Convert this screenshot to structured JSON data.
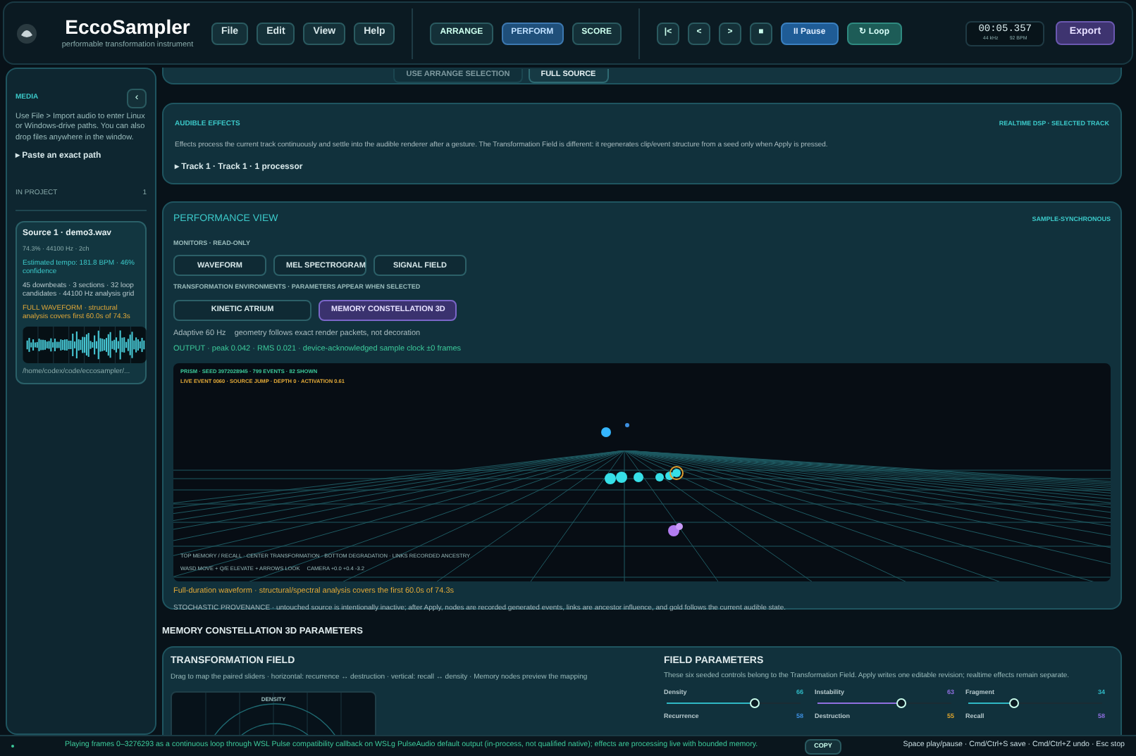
{
  "app": {
    "title": "EccoSampler",
    "subtitle": "performable transformation instrument"
  },
  "menu": [
    {
      "label": "File"
    },
    {
      "label": "Edit"
    },
    {
      "label": "View"
    },
    {
      "label": "Help"
    }
  ],
  "modes": [
    {
      "label": "ARRANGE",
      "selected": false
    },
    {
      "label": "PERFORM",
      "selected": true
    },
    {
      "label": "SCORE",
      "selected": false
    }
  ],
  "transport": [
    {
      "label": "|<",
      "kind": "step"
    },
    {
      "label": "<",
      "kind": "step"
    },
    {
      "label": ">",
      "kind": "step"
    },
    {
      "label": "■",
      "kind": "step"
    },
    {
      "label": "II Pause",
      "kind": "play"
    },
    {
      "label": "↻ Loop",
      "kind": "loop"
    }
  ],
  "clock": {
    "time": "00:05.357",
    "rate": "44 kHz",
    "tempo": "92 BPM"
  },
  "export": "Export",
  "sidebar": {
    "title": "MEDIA",
    "collapse": "‹",
    "help": "Use File > Import audio to enter Linux or Windows-drive paths. You can also drop files anywhere in the window.",
    "paste": "▸ Paste an exact path",
    "project_label": "IN PROJECT",
    "project_count": "1",
    "source": {
      "name": "Source 1 · demo3.wav",
      "meta": "74.3% · 44100 Hz · 2ch",
      "tempo": "Estimated tempo: 181.8 BPM · 46% confidence",
      "analysis": "45 downbeats · 3 sections · 32 loop candidates · 44100 Hz analysis grid",
      "warning": "FULL WAVEFORM · structural analysis covers first 60.0s of 74.3s",
      "path": "/home/codex/code/eccosampler/..."
    }
  },
  "scope": [
    {
      "label": "USE ARRANGE SELECTION",
      "selected": false
    },
    {
      "label": "FULL SOURCE",
      "selected": true
    }
  ],
  "effects": {
    "title": "AUDIBLE EFFECTS",
    "tag": "REALTIME DSP · SELECTED TRACK",
    "text": "Effects process the current track continuously and settle into the audible renderer after a gesture. The Transformation Field is different: it regenerates clip/event structure from a seed only when Apply is pressed.",
    "track": "▸ Track 1 · Track 1 · 1 processor"
  },
  "performance": {
    "title": "PERFORMANCE VIEW",
    "tag": "SAMPLE-SYNCHRONOUS",
    "monitors_label": "MONITORS · READ-ONLY",
    "monitors": [
      {
        "label": "WAVEFORM",
        "selected": false
      },
      {
        "label": "MEL SPECTROGRAM",
        "selected": false
      },
      {
        "label": "SIGNAL FIELD",
        "selected": false
      }
    ],
    "environments_label": "TRANSFORMATION ENVIRONMENTS · PARAMETERS APPEAR WHEN SELECTED",
    "environments": [
      {
        "label": "KINETIC ATRIUM",
        "selected": false
      },
      {
        "label": "MEMORY CONSTELLATION 3D",
        "selected": true
      }
    ],
    "rate": "Adaptive 60 Hz",
    "rate_note": "geometry follows exact render packets, not decoration",
    "output": "OUTPUT · peak 0.042 · RMS 0.021 · device-acknowledged sample clock ±0 frames",
    "canvas": {
      "prism": "PRISM · SEED 3972028945 · 799 EVENTS · 82 SHOWN",
      "live": "LIVE EVENT 0060 · SOURCE JUMP · DEPTH 0 · ACTIVATION 0.61",
      "legend": "TOP MEMORY / RECALL · CENTER TRANSFORMATION · BOTTOM DEGRADATION · LINKS RECORDED ANCESTRY",
      "controls": "WASD MOVE + Q/E ELEVATE + ARROWS LOOK",
      "camera": "CAMERA +0.0 +0.4 -3.2"
    },
    "coverage": "Full-duration waveform · structural/spectral analysis covers the first 60.0s of 74.3s",
    "provenance": "STOCHASTIC PROVENANCE · untouched source is intentionally inactive; after Apply, nodes are recorded generated events, links are ancestor influence, and gold follows the current audible state."
  },
  "parameters": {
    "heading": "MEMORY CONSTELLATION 3D PARAMETERS",
    "field": {
      "title": "TRANSFORMATION FIELD",
      "text": "Drag to map the paired sliders · horizontal: recurrence ↔ destruction · vertical: recall ↔ density · Memory nodes preview the mapping",
      "axis": "DENSITY"
    },
    "panel": {
      "title": "FIELD PARAMETERS",
      "text": "These six seeded controls belong to the Transformation Field. Apply writes one editable revision; realtime effects remain separate."
    },
    "sliders": [
      {
        "label": "Density",
        "value": "66",
        "level": 0.66,
        "color": "#2fb8c4"
      },
      {
        "label": "Instability",
        "value": "63",
        "level": 0.63,
        "color": "#8f6fe0"
      },
      {
        "label": "Fragment",
        "value": "34",
        "level": 0.34,
        "color": "#2fb8c4"
      },
      {
        "label": "Recurrence",
        "value": "58",
        "color": "#3d8fe0"
      },
      {
        "label": "Destruction",
        "value": "55",
        "color": "#d9a22e"
      },
      {
        "label": "Recall",
        "value": "58",
        "color": "#8f6fe0"
      }
    ]
  },
  "status": {
    "text": "Playing frames 0–3276293 as a continuous loop through WSL Pulse compatibility callback on WSLg PulseAudio default output (in-process, not qualified native); effects are processing live with bounded memory.",
    "copy": "COPY",
    "shortcuts": "Space play/pause · Cmd/Ctrl+S save · Cmd/Ctrl+Z undo · Esc stop"
  }
}
